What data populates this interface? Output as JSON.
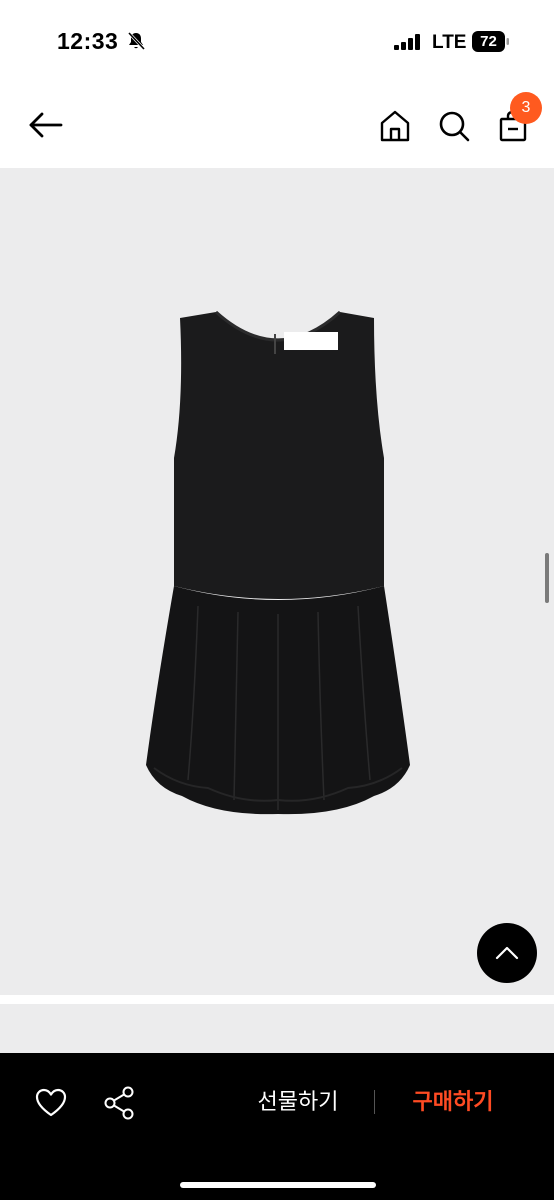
{
  "status_bar": {
    "time": "12:33",
    "network": "LTE",
    "battery": "72"
  },
  "header": {
    "cart_count": "3"
  },
  "product": {
    "image_description_icon": "black-sleeveless-bubble-dress"
  },
  "actions": {
    "gift_label": "선물하기",
    "buy_label": "구매하기"
  },
  "colors": {
    "accent": "#ff5a1f",
    "buy_text": "#ff4b23",
    "image_bg": "#ececed",
    "bottom_bar": "#000000"
  }
}
